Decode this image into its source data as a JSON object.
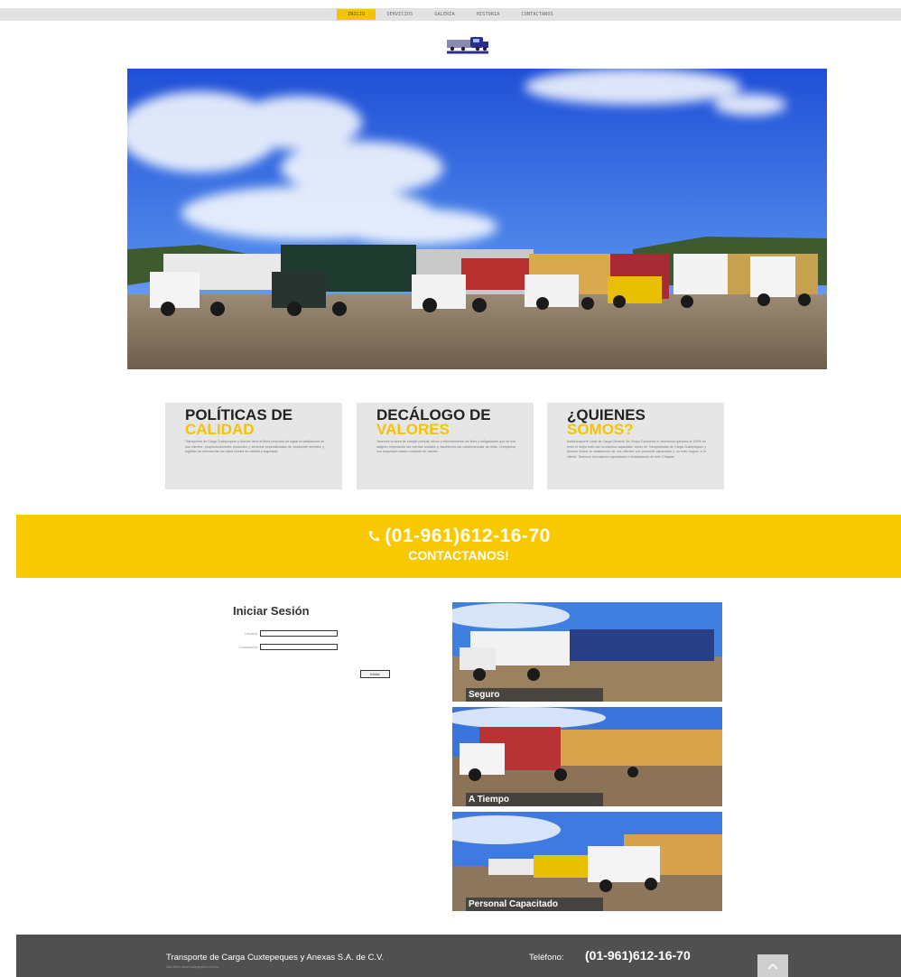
{
  "nav": {
    "items": [
      "INICIO",
      "SERVICIOS",
      "GALERIA",
      "HISTORIA",
      "CONTACTANOS"
    ],
    "active": "INICIO"
  },
  "logo": {
    "name": "truck-logo",
    "text": "CUXTEPEQUES"
  },
  "cards": [
    {
      "title1": "POLÍTICAS DE",
      "title2": "CALIDAD",
      "body": "Transportes de Carga Cuxtepeques y Anexas tiene el firme propósito de lograr la satisfacción de sus clientes, proporcionándoles productos y servicios especializados de transporte terrestre y logístico de mercancías con altos niveles de calidad y seguridad."
    },
    {
      "title1": "DECÁLOGO DE",
      "title2": "VALORES",
      "body": "Tenemos la tarea de cumplir puntual, eficaz y eficientemente los fines y obligaciones que se nos asignen respetando las normas sociales y asumiendo las consecuencias de ellas. Cumplimos con seguridad nuestro conjunto de valores."
    },
    {
      "title1": "¿QUIENES",
      "title2": "SOMOS?",
      "body": "Autotransporte Local de Carga General, 8o Grupo Camiones le ofrecemos garantía al 100% en tener el mejor trato con la máxima capacidad. Unión de Transportistas de Carga Cuxtepeques y Anexas busca la satisfacción de sus clientes con personal capacitado y un trato seguro a el cliente. Tenemos los mejores capacitados e instalaciones de todo Chiapas."
    }
  ],
  "banner": {
    "phone": "(01-961)612-16-70",
    "cta": "CONTACTANOS!",
    "icon": "phone-icon"
  },
  "login": {
    "title": "Iniciar Sesión",
    "user_label": "Usuario:",
    "user_value": "",
    "pass_label": "Contraseña:",
    "pass_value": "",
    "button": "Iniciar"
  },
  "gallery": [
    {
      "caption": "Seguro"
    },
    {
      "caption": "A Tiempo"
    },
    {
      "caption": "Personal Capacitado"
    }
  ],
  "footer": {
    "company": "Transporte de Carga Cuxtepeques y Anexas S.A. de C.V.",
    "small": "Sitio Web: www.cuxtepeques.com.mx",
    "phone_label": "Teléfono:",
    "phone": "(01-961)612-16-70",
    "scroll_top_icon": "chevron-up-icon"
  },
  "colors": {
    "accent": "#f8c900",
    "footer": "#505050",
    "card": "#e6e6e6"
  }
}
